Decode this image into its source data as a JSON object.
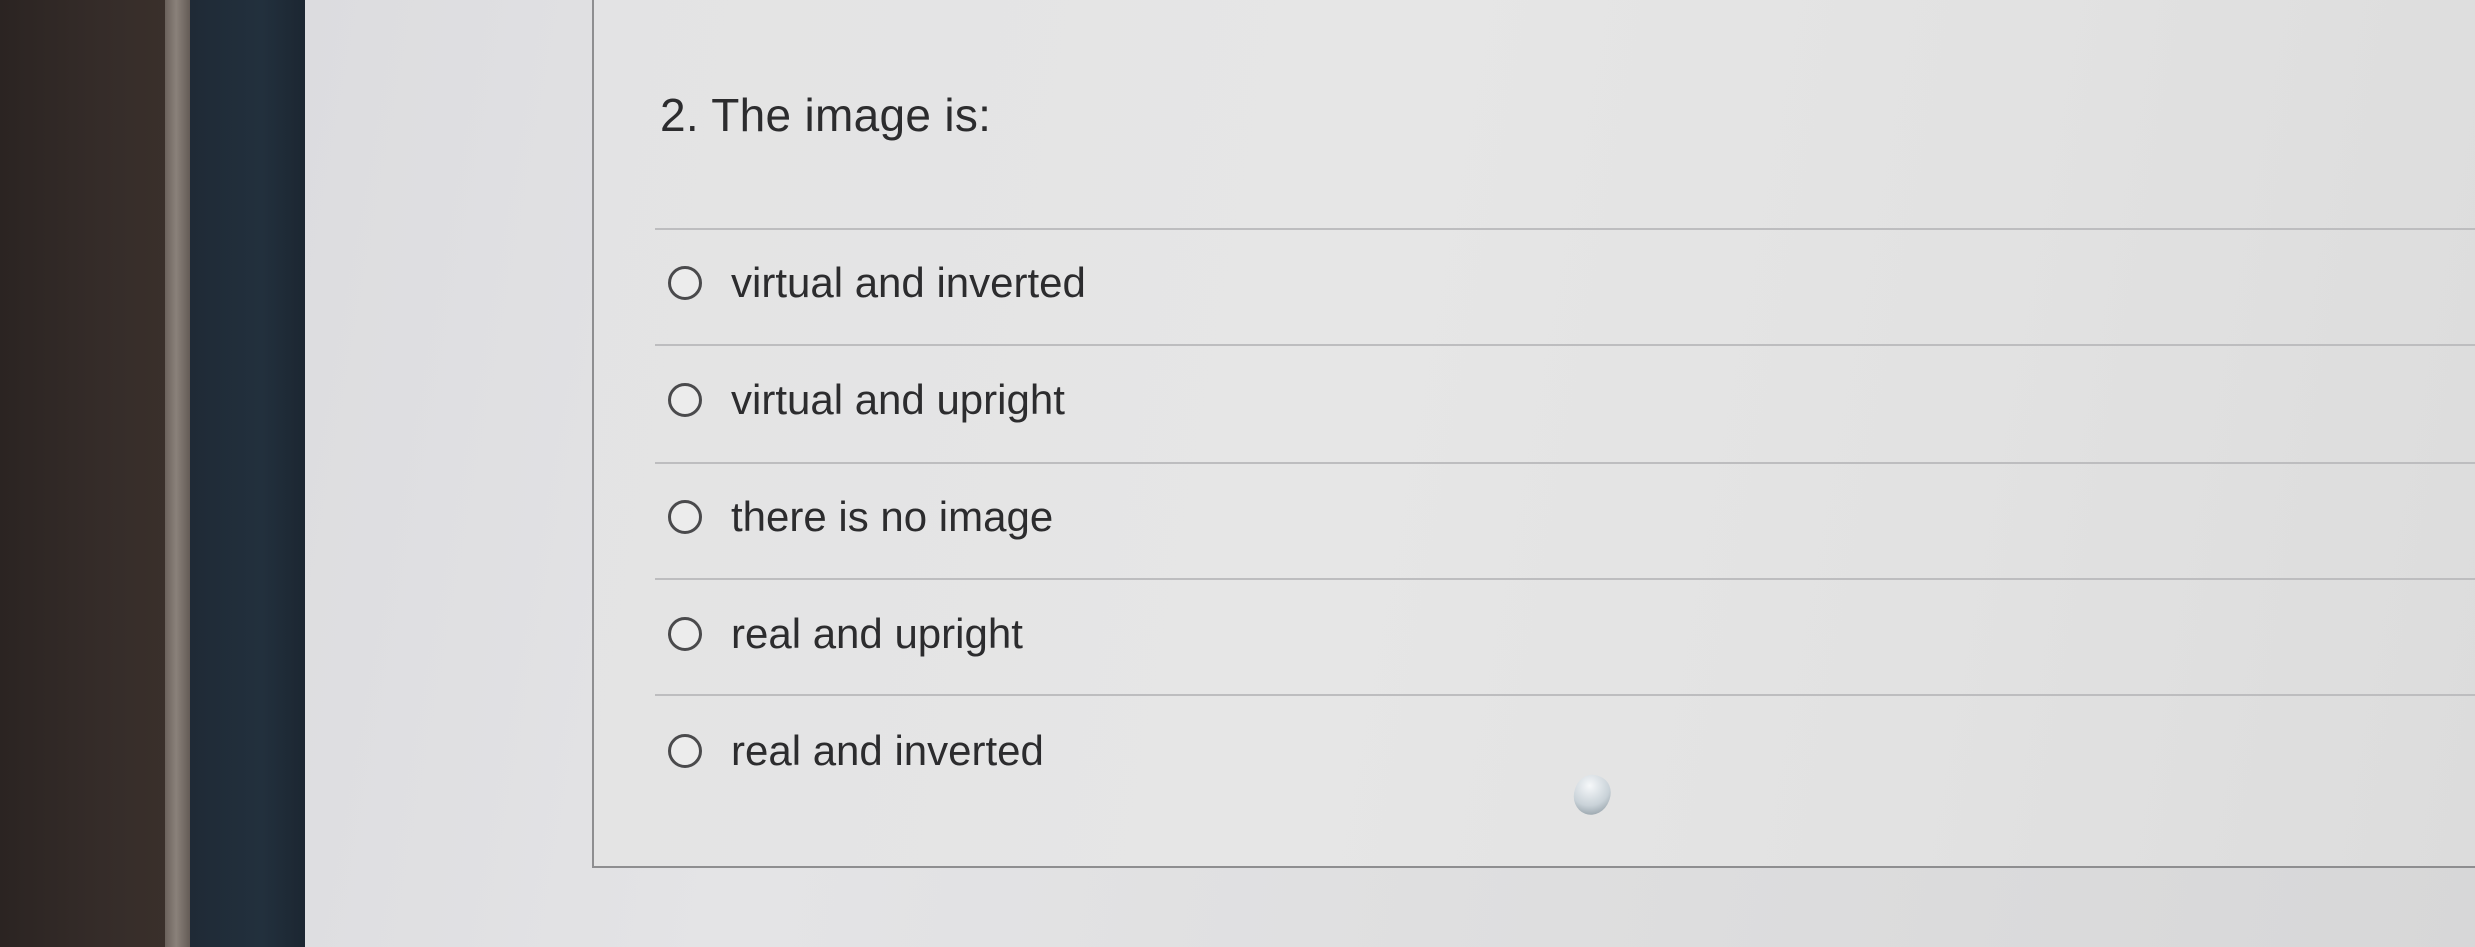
{
  "question": {
    "number": "2.",
    "text": "The image is:"
  },
  "options": [
    {
      "label": "virtual and inverted",
      "selected": false
    },
    {
      "label": "virtual and upright",
      "selected": false
    },
    {
      "label": "there is no image",
      "selected": false
    },
    {
      "label": "real and upright",
      "selected": false
    },
    {
      "label": "real and inverted",
      "selected": false
    }
  ],
  "icons": {
    "radio": "radio-unchecked-icon"
  }
}
